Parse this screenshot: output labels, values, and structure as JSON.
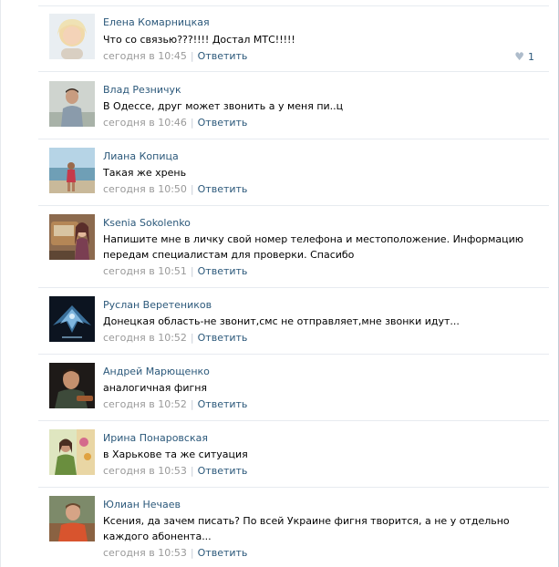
{
  "comments": [
    {
      "author": "Елена Комарницкая",
      "text": "Что со связью???!!!! Достал МТС!!!!!",
      "date": "сегодня в 10:45",
      "reply": "Ответить",
      "likes": "1",
      "heart_icon": "heart-icon"
    },
    {
      "author": "Влад Резничук",
      "text": "В Одессе, друг может звонить а у меня пи..ц",
      "date": "сегодня в 10:46",
      "reply": "Ответить"
    },
    {
      "author": "Лиана Копица",
      "text": "Такая же хрень",
      "date": "сегодня в 10:50",
      "reply": "Ответить"
    },
    {
      "author": "Ksenia Sokolenko",
      "text": "Напишите мне в личку свой номер телефона и местоположение. Информацию передам специалистам для проверки. Спасибо",
      "date": "сегодня в 10:51",
      "reply": "Ответить"
    },
    {
      "author": "Руслан Веретеников",
      "text": "Донецкая область-не звонит,смс не отправляет,мне звонки идут...",
      "date": "сегодня в 10:52",
      "reply": "Ответить"
    },
    {
      "author": "Андрей Марющенко",
      "text": "аналогичная фигня",
      "date": "сегодня в 10:52",
      "reply": "Ответить"
    },
    {
      "author": "Ирина Понаровская",
      "text": "в Харькове та же ситуация",
      "date": "сегодня в 10:53",
      "reply": "Ответить"
    },
    {
      "author": "Юлиан Нечаев",
      "text": "Ксения, да зачем писать? По всей Украине фигня творится, а не у отдельно каждого абонента...",
      "date": "сегодня в 10:53",
      "reply": "Ответить"
    }
  ],
  "separator": "|",
  "colors": {
    "link": "#2b587a",
    "meta": "#999999",
    "divider": "#e7ebf0"
  }
}
